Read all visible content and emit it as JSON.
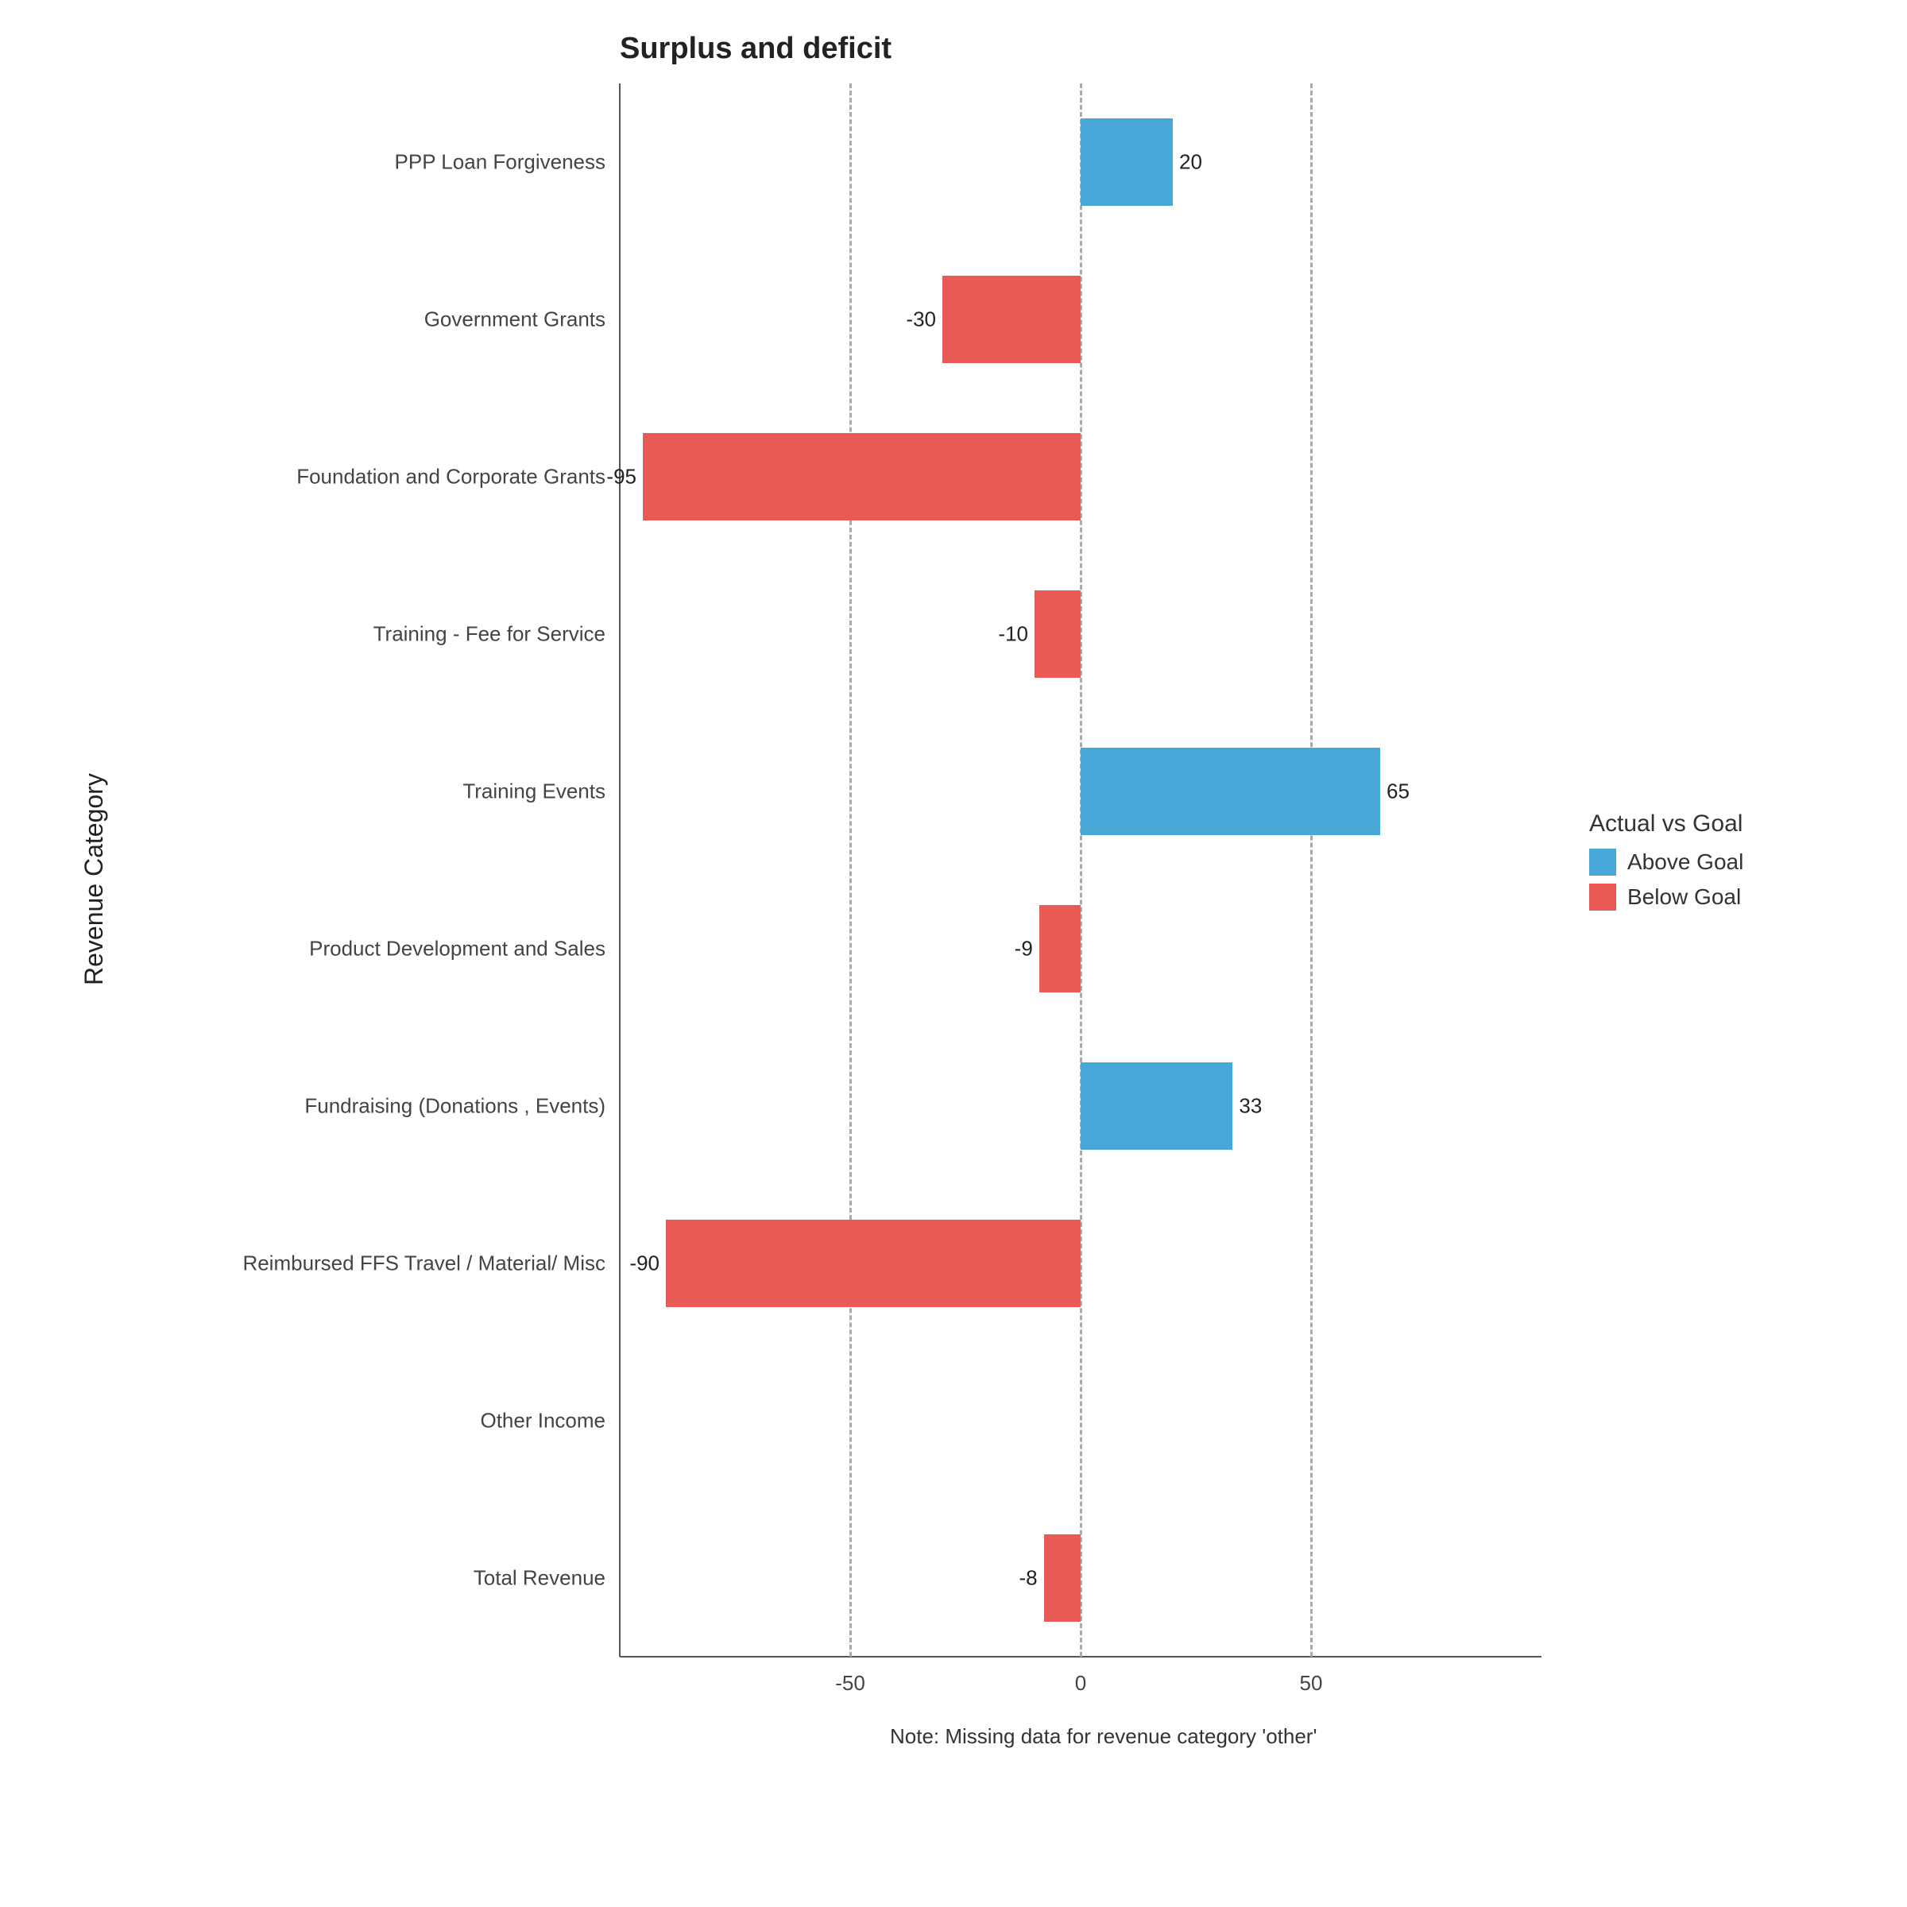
{
  "chart_data": {
    "type": "bar",
    "orientation": "horizontal",
    "title": "Surplus and deficit",
    "ylabel": "Revenue Category",
    "xlabel": "",
    "xlim": [
      -100,
      100
    ],
    "x_ticks": [
      -50,
      0,
      50
    ],
    "grid_x": [
      -50,
      0,
      50
    ],
    "caption": "Note:  Missing data for revenue category 'other'",
    "legend": {
      "title": "Actual vs Goal",
      "items": [
        {
          "key": "above",
          "label": "Above Goal",
          "color": "#4aa8d8"
        },
        {
          "key": "below",
          "label": "Below Goal",
          "color": "#e85a55"
        }
      ]
    },
    "categories": [
      "PPP Loan Forgiveness",
      "Government Grants",
      "Foundation and Corporate Grants",
      "Training - Fee for Service",
      "Training Events",
      "Product Development and Sales",
      "Fundraising (Donations , Events)",
      "Reimbursed FFS Travel / Material/ Misc",
      "Other Income",
      "Total Revenue"
    ],
    "values": [
      20,
      -30,
      -95,
      -10,
      65,
      -9,
      33,
      -90,
      null,
      -8
    ],
    "series_key": [
      "above",
      "below",
      "below",
      "below",
      "above",
      "below",
      "above",
      "below",
      null,
      "below"
    ]
  }
}
